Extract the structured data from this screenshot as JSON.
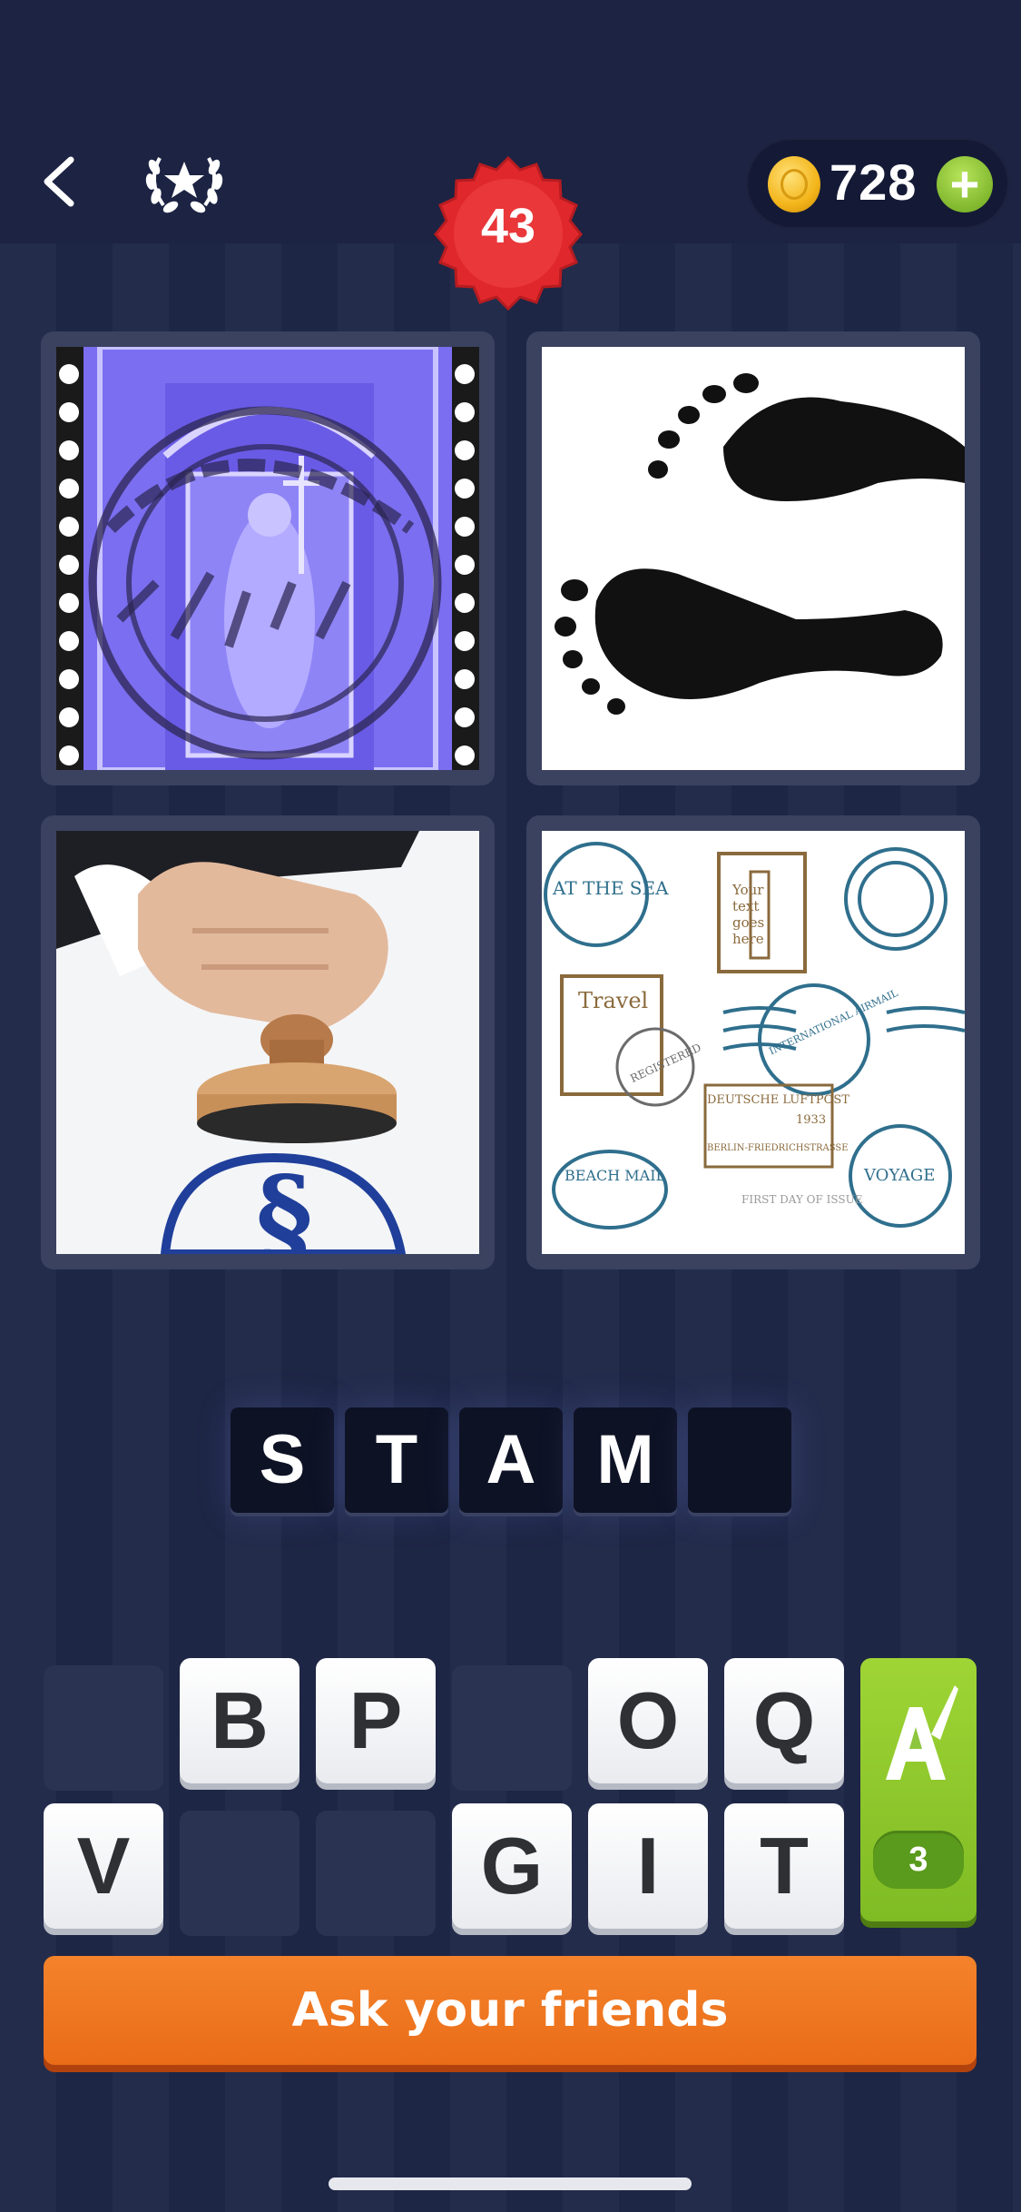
{
  "header": {
    "coins": "728",
    "level": "43",
    "back_icon": "chevron-left-icon",
    "achievements_icon": "laurel-star-icon"
  },
  "pictures": [
    {
      "caption": "Purple postage stamp with postmark"
    },
    {
      "caption": "Black footprints"
    },
    {
      "caption": "Hand pressing a rubber stamp"
    },
    {
      "caption": "Assorted vintage postal stamps"
    }
  ],
  "stamp_texts": {
    "p4_sea": "AT THE SEA",
    "p4_your": "Your",
    "p4_text": "text",
    "p4_goes": "goes",
    "p4_here": "here",
    "p4_travel": "Travel",
    "p4_registered": "REGISTERED",
    "p4_luftpost": "DEUTSCHE LUFTPOST",
    "p4_1933": "1933",
    "p4_berlin": "BERLIN-FRIEDRICHSTRASSE",
    "p4_first_day": "FIRST DAY OF ISSUE",
    "p4_beach": "BEACH MAIL",
    "p4_voyage": "VOYAGE",
    "p4_intl": "INTERNATIONAL AIRMAIL"
  },
  "answer_slots": [
    "S",
    "T",
    "A",
    "M",
    ""
  ],
  "keyboard": {
    "row1": [
      "",
      "B",
      "P",
      "",
      "O",
      "Q"
    ],
    "row2": [
      "V",
      "",
      "",
      "G",
      "I",
      "T"
    ]
  },
  "hint": {
    "count": "3"
  },
  "ask_button": "Ask your friends",
  "colors": {
    "background": "#1f2748",
    "level_badge": "#e0282c",
    "hint_green": "#8cc63f",
    "ask_orange": "#f07a22"
  }
}
